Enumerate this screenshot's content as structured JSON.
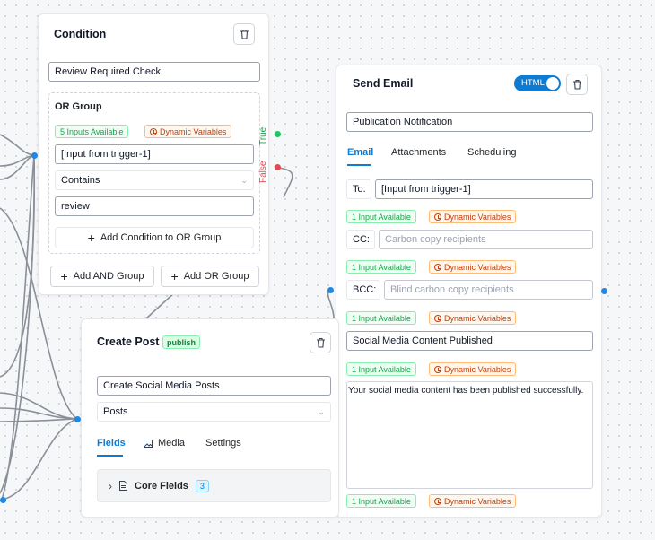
{
  "condition": {
    "title": "Condition",
    "name_value": "Review Required Check",
    "group_title": "OR Group",
    "inputs_badge": "5 Inputs Available",
    "dynamic_badge": "Dynamic Variables",
    "input_value": "[Input from trigger-1]",
    "operator": "Contains",
    "compare_value": "review",
    "add_condition_label": "Add Condition to OR Group",
    "add_and_label": "Add AND Group",
    "add_or_label": "Add OR Group",
    "true_label": "True",
    "false_label": "False"
  },
  "send_email": {
    "title": "Send Email",
    "toggle_label": "HTML",
    "toggle_on": true,
    "name_value": "Publication Notification",
    "tabs": [
      "Email",
      "Attachments",
      "Scheduling"
    ],
    "active_tab": "Email",
    "to_label": "To:",
    "to_value": "[Input from trigger-1]",
    "to_input_badge": "1 Input Available",
    "to_dynamic_badge": "Dynamic Variables",
    "cc_label": "CC:",
    "cc_placeholder": "Carbon copy recipients",
    "cc_input_badge": "1 Input Available",
    "cc_dynamic_badge": "Dynamic Variables",
    "bcc_label": "BCC:",
    "bcc_placeholder": "Blind carbon copy recipients",
    "bcc_input_badge": "1 Input Available",
    "bcc_dynamic_badge": "Dynamic Variables",
    "subject_value": "Social Media Content Published",
    "subject_input_badge": "1 Input Available",
    "subject_dynamic_badge": "Dynamic Variables",
    "body_value": "Your social media content has been published successfully.",
    "body_input_badge": "1 Input Available",
    "body_dynamic_badge": "Dynamic Variables"
  },
  "create_post": {
    "title": "Create Post",
    "status_badge": "publish",
    "name_value": "Create Social Media Posts",
    "type_value": "Posts",
    "tabs": [
      "Fields",
      "Media",
      "Settings"
    ],
    "active_tab": "Fields",
    "section_label": "Core Fields",
    "section_count": "3"
  },
  "colors": {
    "accent": "#0b7bd4",
    "port": "#1e88e5",
    "true_port": "#22c55e",
    "false_port": "#e5484d",
    "badge_green": "#16a34a",
    "badge_orange": "#c2410c"
  }
}
